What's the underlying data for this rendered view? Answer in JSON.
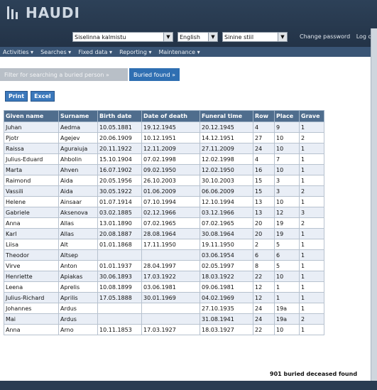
{
  "app": {
    "logo": "HAUDI"
  },
  "header": {
    "cemetery_select": "Siselinna kalmistu",
    "language_select": "English",
    "style_select": "Sinine stiil",
    "links": [
      "Change password",
      "Log out"
    ]
  },
  "nav": [
    "Activities ▾",
    "Searches ▾",
    "Fixed data ▾",
    "Reporting ▾",
    "Maintenance ▾"
  ],
  "breadcrumbs": {
    "first": "Filter for searching a buried person »",
    "second": "Buried found »"
  },
  "toolbar": {
    "print_label": "Print",
    "excel_label": "Excel"
  },
  "table": {
    "headers": [
      "Given name",
      "Surname",
      "Birth date",
      "Date of death",
      "Funeral time",
      "Row",
      "Place",
      "Grave"
    ],
    "rows": [
      [
        "Juhan",
        "Aedma",
        "10.05.1881",
        "19.12.1945",
        "20.12.1945",
        "4",
        "9",
        "1"
      ],
      [
        "Pjotr",
        "Agejev",
        "20.06.1909",
        "10.12.1951",
        "14.12.1951",
        "27",
        "10",
        "2"
      ],
      [
        "Raissa",
        "Aguraiuja",
        "20.11.1922",
        "12.11.2009",
        "27.11.2009",
        "24",
        "10",
        "1"
      ],
      [
        "Julius-Eduard",
        "Ahbolin",
        "15.10.1904",
        "07.02.1998",
        "12.02.1998",
        "4",
        "7",
        "1"
      ],
      [
        "Marta",
        "Ahven",
        "16.07.1902",
        "09.02.1950",
        "12.02.1950",
        "16",
        "10",
        "1"
      ],
      [
        "Raimond",
        "Aida",
        "20.05.1956",
        "26.10.2003",
        "30.10.2003",
        "15",
        "3",
        "1"
      ],
      [
        "Vassili",
        "Aida",
        "30.05.1922",
        "01.06.2009",
        "06.06.2009",
        "15",
        "3",
        "2"
      ],
      [
        "Helene",
        "Ainsaar",
        "01.07.1914",
        "07.10.1994",
        "12.10.1994",
        "13",
        "10",
        "1"
      ],
      [
        "Gabriele",
        "Aksenova",
        "03.02.1885",
        "02.12.1966",
        "03.12.1966",
        "13",
        "12",
        "3"
      ],
      [
        "Anna",
        "Allas",
        "13.01.1890",
        "07.02.1965",
        "07.02.1965",
        "20",
        "19",
        "2"
      ],
      [
        "Karl",
        "Allas",
        "20.08.1887",
        "28.08.1964",
        "30.08.1964",
        "20",
        "19",
        "1"
      ],
      [
        "Liisa",
        "Alt",
        "01.01.1868",
        "17.11.1950",
        "19.11.1950",
        "2",
        "5",
        "1"
      ],
      [
        "Theodor",
        "Altsep",
        "",
        "",
        "03.06.1954",
        "6",
        "6",
        "1"
      ],
      [
        "Virve",
        "Anton",
        "01.01.1937",
        "28.04.1997",
        "02.05.1997",
        "8",
        "5",
        "1"
      ],
      [
        "Henriette",
        "Apiakas",
        "30.06.1893",
        "17.03.1922",
        "18.03.1922",
        "22",
        "10",
        "1"
      ],
      [
        "Leena",
        "Aprelis",
        "10.08.1899",
        "03.06.1981",
        "09.06.1981",
        "12",
        "1",
        "1"
      ],
      [
        "Julius-Richard",
        "Aprilis",
        "17.05.1888",
        "30.01.1969",
        "04.02.1969",
        "12",
        "1",
        "1"
      ],
      [
        "Johannes",
        "Ardus",
        "",
        "",
        "27.10.1935",
        "24",
        "19a",
        "1"
      ],
      [
        "Mai",
        "Ardus",
        "",
        "",
        "31.08.1941",
        "24",
        "19a",
        "2"
      ],
      [
        "Anna",
        "Arno",
        "10.11.1853",
        "17.03.1927",
        "18.03.1927",
        "22",
        "10",
        "1"
      ]
    ]
  },
  "footer": {
    "count_text": "901 buried deceased found"
  }
}
